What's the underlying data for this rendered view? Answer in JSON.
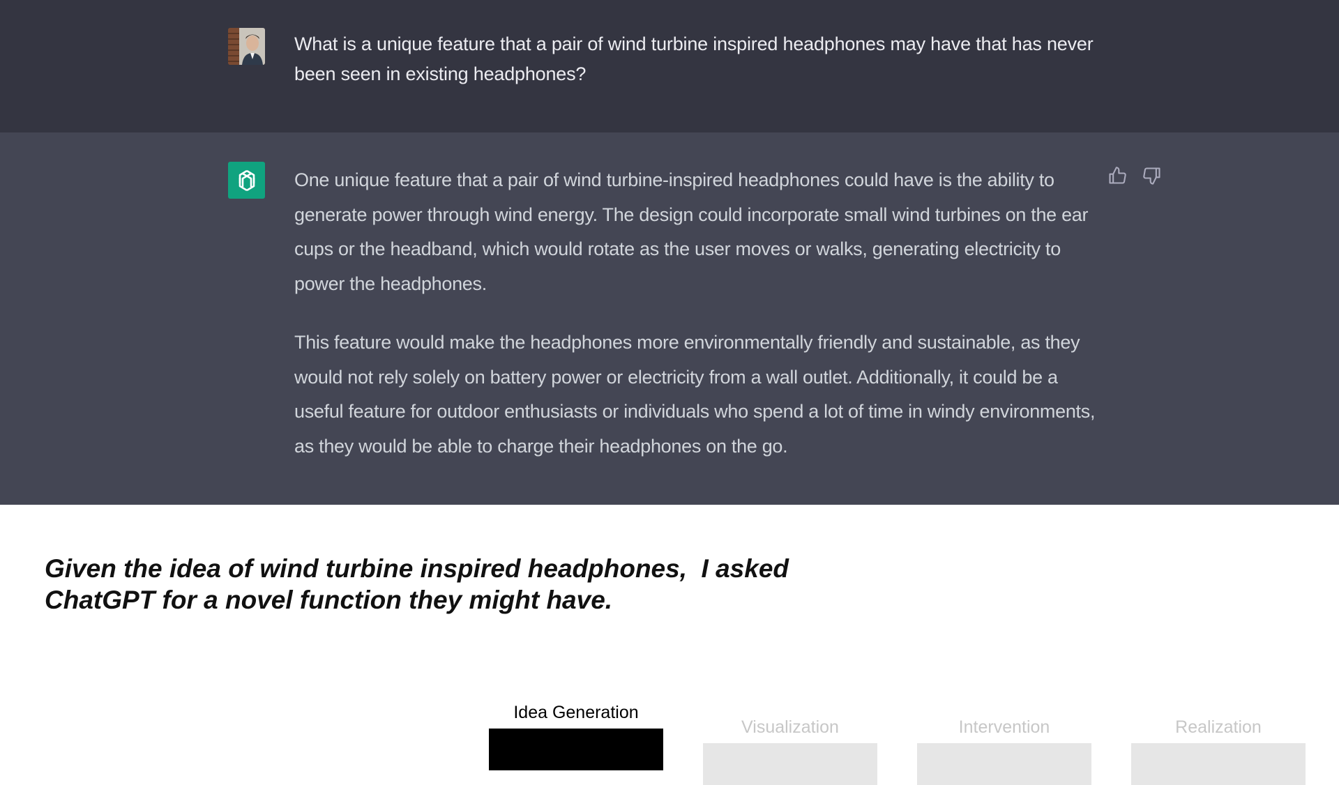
{
  "conversation": {
    "user_message": "What is a unique feature that a pair of wind turbine inspired headphones may have that has never been seen in existing headphones?",
    "assistant_paragraphs": [
      "One unique feature that a pair of wind turbine-inspired headphones could have is the ability to generate power through wind energy. The design could incorporate small wind turbines on the ear cups or the headband, which would rotate as the user moves or walks, generating electricity to power the headphones.",
      "This feature would make the headphones more environmentally friendly and sustainable, as they would not rely solely on battery power or electricity from a wall outlet. Additionally, it could be a useful feature for outdoor enthusiasts or individuals who spend a lot of time in windy environments, as they would be able to charge their headphones on the go."
    ],
    "feedback_icons": [
      "thumbs-up-icon",
      "thumbs-down-icon"
    ]
  },
  "caption": {
    "line1": "Given the idea of wind turbine inspired headphones,  I asked",
    "line2": "ChatGPT for a novel function they might have."
  },
  "stages": [
    {
      "label": "Idea Generation",
      "active": true
    },
    {
      "label": "Visualization",
      "active": false
    },
    {
      "label": "Intervention",
      "active": false
    },
    {
      "label": "Realization",
      "active": false
    }
  ],
  "colors": {
    "user_bg": "#343541",
    "assistant_bg": "#444654",
    "bot_avatar": "#10a37f",
    "stage_active": "#000000",
    "stage_inactive": "#e6e6e6"
  }
}
